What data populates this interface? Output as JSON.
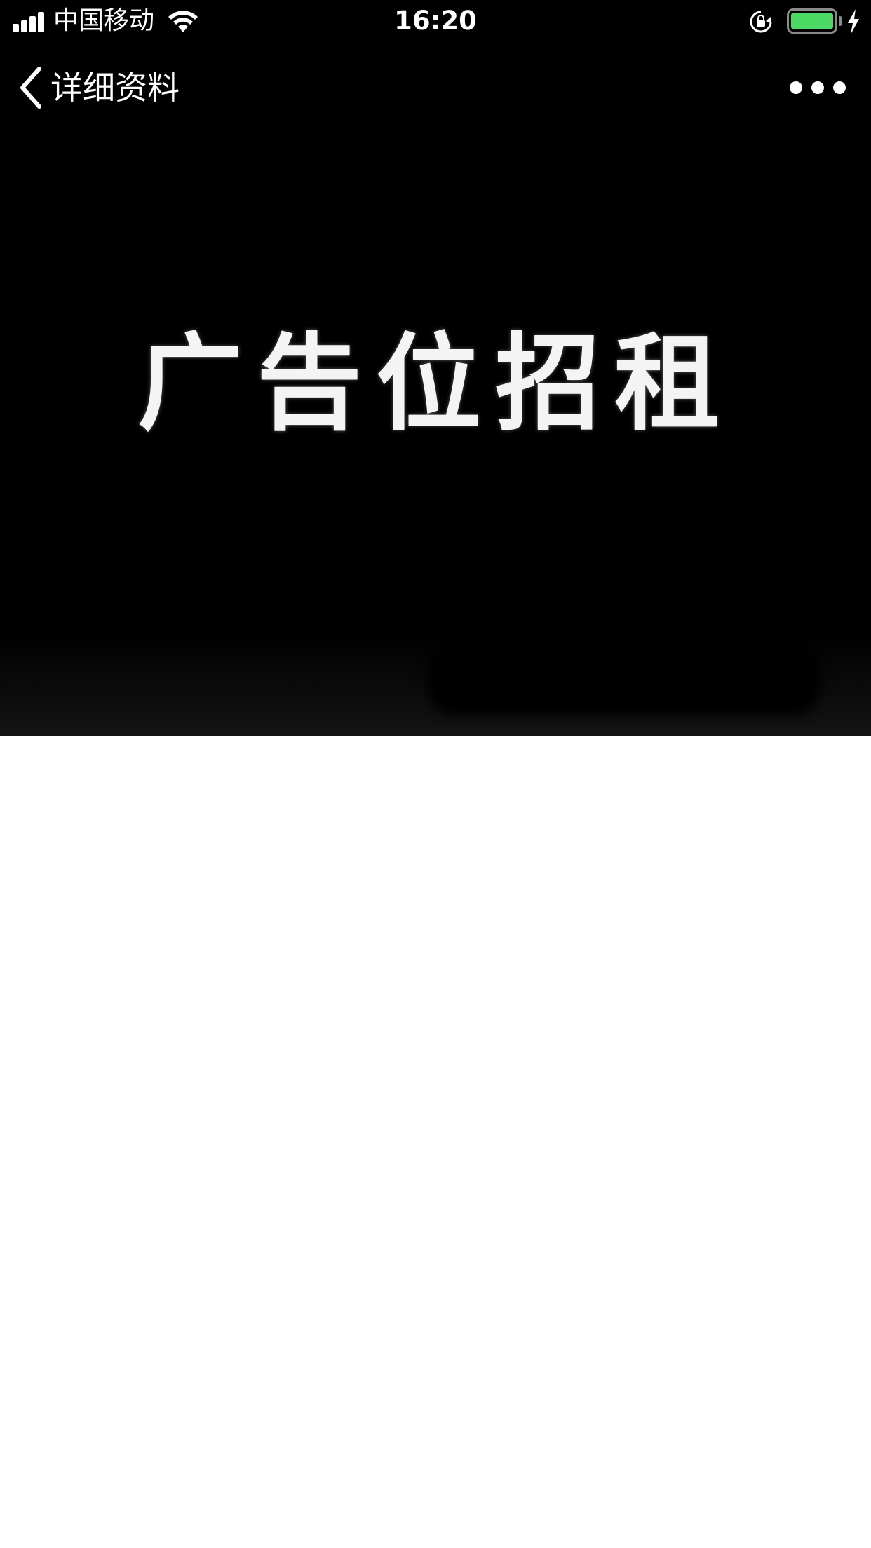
{
  "status_bar": {
    "carrier": "中国移动",
    "time": "16:20",
    "battery_level": 1.0,
    "charging": true,
    "icons": [
      "signal-icon",
      "wifi-icon",
      "rotation-lock-icon",
      "battery-icon",
      "charging-icon"
    ]
  },
  "nav": {
    "back_label": "详细资料",
    "back_icon": "chevron-left-icon",
    "more_icon": "more-dots-icon"
  },
  "banner": {
    "text": "广告位招租"
  },
  "colors": {
    "background_dark": "#000000",
    "text_light": "#ffffff",
    "battery_fill": "#4cd964",
    "page_background": "#ffffff"
  }
}
